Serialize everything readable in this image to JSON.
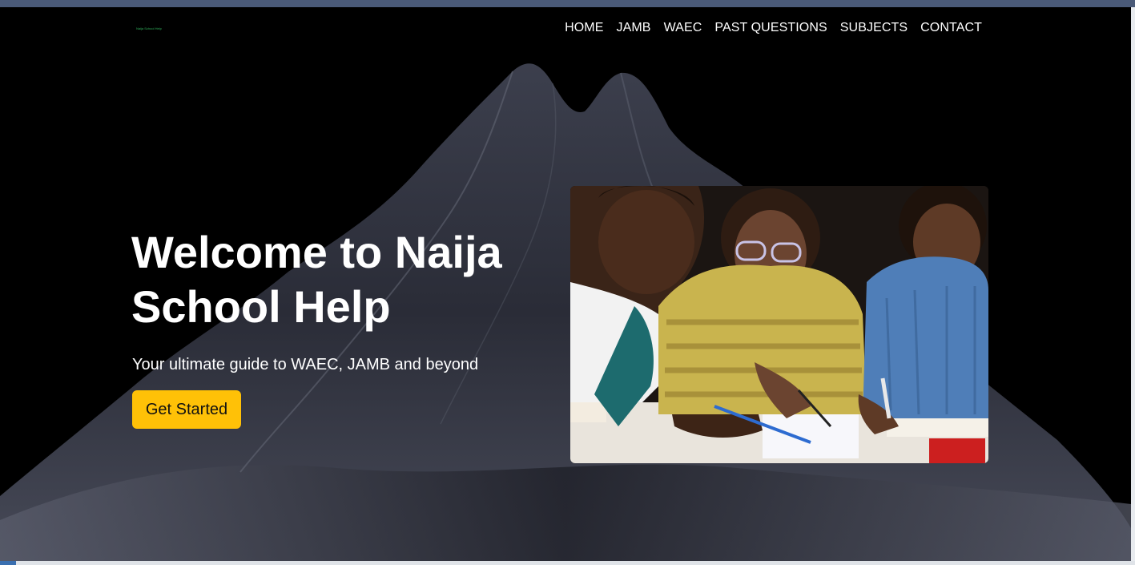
{
  "brand": {
    "logo_alt": "Naija School Help"
  },
  "nav": {
    "items": [
      "HOME",
      "JAMB",
      "WAEC",
      "PAST QUESTIONS",
      "SUBJECTS",
      "CONTACT"
    ]
  },
  "hero": {
    "title": "Welcome to Naija School Help",
    "subtitle": "Your ultimate guide to WAEC, JAMB and beyond",
    "cta_label": "Get Started",
    "image_alt": "Three students studying together with books and pens"
  },
  "colors": {
    "accent": "#ffc107",
    "background": "#000000",
    "text": "#ffffff",
    "top_strip": "#4a5a78"
  },
  "icons": {
    "logo": "naija-school-help-logo"
  }
}
